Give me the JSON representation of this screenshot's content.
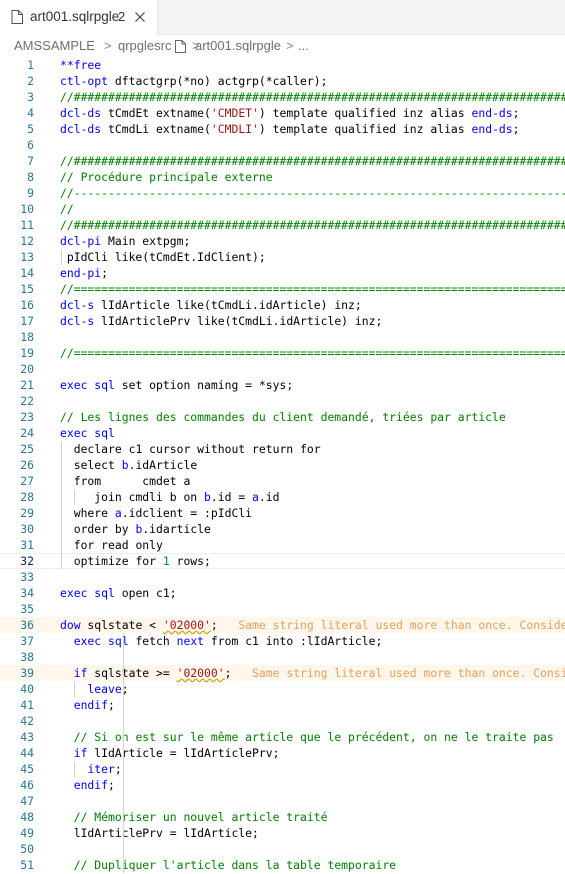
{
  "tab": {
    "title": "art001.sqlrpgle",
    "badge": "2",
    "file_icon": "file-icon",
    "close_icon": "close-icon"
  },
  "breadcrumb": {
    "items": [
      "AMSSAMPLE",
      "qrpglesrc",
      "art001.sqlrpgle",
      "..."
    ],
    "separator": ">"
  },
  "editor": {
    "current_line": 32,
    "colors": {
      "line_number": "#237893",
      "keyword": "#0000ff",
      "comment": "#008000",
      "string": "#a31515",
      "number": "#098658",
      "warning": "#e8a05c"
    },
    "lines": [
      {
        "n": "1",
        "text": "**free"
      },
      {
        "n": "2",
        "text": "ctl-opt dftactgrp(*no) actgrp(*caller);"
      },
      {
        "n": "3",
        "text": "//###########################################################################"
      },
      {
        "n": "4",
        "text": "dcl-ds tCmdEt extname('CMDET') template qualified inz alias end-ds;"
      },
      {
        "n": "5",
        "text": "dcl-ds tCmdLi extname('CMDLI') template qualified inz alias end-ds;"
      },
      {
        "n": "6",
        "text": ""
      },
      {
        "n": "7",
        "text": "//###########################################################################"
      },
      {
        "n": "8",
        "text": "// Procédure principale externe"
      },
      {
        "n": "9",
        "text": "//---------------------------------------------------------------------------"
      },
      {
        "n": "10",
        "text": "//"
      },
      {
        "n": "11",
        "text": "//###########################################################################"
      },
      {
        "n": "12",
        "text": "dcl-pi Main extpgm;"
      },
      {
        "n": "13",
        "text": "pIdCli like(tCmdEt.IdClient);"
      },
      {
        "n": "14",
        "text": "end-pi;"
      },
      {
        "n": "15",
        "text": "//==========================================================================="
      },
      {
        "n": "16",
        "text": "dcl-s lIdArticle like(tCmdLi.idArticle) inz;"
      },
      {
        "n": "17",
        "text": "dcl-s lIdArticlePrv like(tCmdLi.idArticle) inz;"
      },
      {
        "n": "18",
        "text": ""
      },
      {
        "n": "19",
        "text": "//==========================================================================="
      },
      {
        "n": "20",
        "text": ""
      },
      {
        "n": "21",
        "text": "exec sql set option naming = *sys;"
      },
      {
        "n": "22",
        "text": ""
      },
      {
        "n": "23",
        "text": "// Les lignes des commandes du client demandé, triées par article"
      },
      {
        "n": "24",
        "text": "exec sql"
      },
      {
        "n": "25",
        "text": "declare c1 cursor without return for"
      },
      {
        "n": "26",
        "text": "select b.idArticle"
      },
      {
        "n": "27",
        "text": "from      cmdet a"
      },
      {
        "n": "28",
        "text": "join cmdli b on b.id = a.id"
      },
      {
        "n": "29",
        "text": "where a.idclient = :pIdCli"
      },
      {
        "n": "30",
        "text": "order by b.idarticle"
      },
      {
        "n": "31",
        "text": "for read only"
      },
      {
        "n": "32",
        "text": "optimize for 1 rows;"
      },
      {
        "n": "33",
        "text": ""
      },
      {
        "n": "34",
        "text": "exec sql open c1;"
      },
      {
        "n": "35",
        "text": ""
      },
      {
        "n": "36",
        "text": "dow sqlstate < '02000';",
        "hint": "Same string literal used more than once. Consider"
      },
      {
        "n": "37",
        "text": "exec sql fetch next from c1 into :lIdArticle;"
      },
      {
        "n": "38",
        "text": ""
      },
      {
        "n": "39",
        "text": "if sqlstate >= '02000';",
        "hint": "Same string literal used more than once. Consic"
      },
      {
        "n": "40",
        "text": "leave;"
      },
      {
        "n": "41",
        "text": "endif;"
      },
      {
        "n": "42",
        "text": ""
      },
      {
        "n": "43",
        "text": "// Si on est sur le même article que le précédent, on ne le traite pas"
      },
      {
        "n": "44",
        "text": "if lIdArticle = lIdArticlePrv;"
      },
      {
        "n": "45",
        "text": "iter;"
      },
      {
        "n": "46",
        "text": "endif;"
      },
      {
        "n": "47",
        "text": ""
      },
      {
        "n": "48",
        "text": "// Mémoriser un nouvel article traité"
      },
      {
        "n": "49",
        "text": "lIdArticlePrv = lIdArticle;"
      },
      {
        "n": "50",
        "text": ""
      },
      {
        "n": "51",
        "text": "// Dupliquer l'article dans la table temporaire"
      }
    ]
  }
}
